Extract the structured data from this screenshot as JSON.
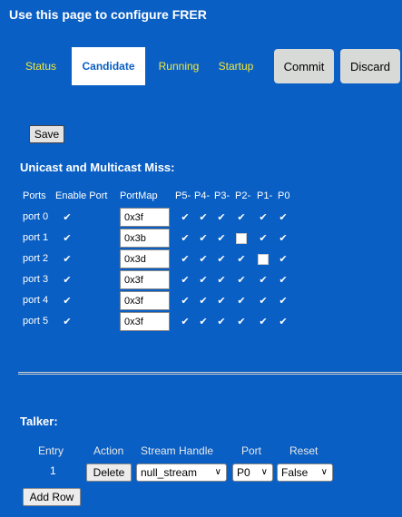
{
  "page_title": "Use this page to configure FRER",
  "tabs": [
    "Status",
    "Candidate",
    "Running",
    "Startup"
  ],
  "active_tab": "Candidate",
  "commit_label": "Commit",
  "discard_label": "Discard",
  "save_label": "Save",
  "miss": {
    "title": "Unicast and Multicast Miss:",
    "headers": [
      "Ports",
      "Enable Port",
      "PortMap",
      "P5-",
      "P4-",
      "P3-",
      "P2-",
      "P1-",
      "P0"
    ],
    "rows": [
      {
        "port": "port 0",
        "enable": true,
        "portmap": "0x3f",
        "bits": [
          true,
          true,
          true,
          true,
          true,
          true
        ]
      },
      {
        "port": "port 1",
        "enable": true,
        "portmap": "0x3b",
        "bits": [
          true,
          true,
          true,
          false,
          true,
          true
        ]
      },
      {
        "port": "port 2",
        "enable": true,
        "portmap": "0x3d",
        "bits": [
          true,
          true,
          true,
          true,
          false,
          true
        ]
      },
      {
        "port": "port 3",
        "enable": true,
        "portmap": "0x3f",
        "bits": [
          true,
          true,
          true,
          true,
          true,
          true
        ]
      },
      {
        "port": "port 4",
        "enable": true,
        "portmap": "0x3f",
        "bits": [
          true,
          true,
          true,
          true,
          true,
          true
        ]
      },
      {
        "port": "port 5",
        "enable": true,
        "portmap": "0x3f",
        "bits": [
          true,
          true,
          true,
          true,
          true,
          true
        ]
      }
    ]
  },
  "talker": {
    "title": "Talker:",
    "headers": [
      "Entry",
      "Action",
      "Stream Handle",
      "Port",
      "Reset"
    ],
    "rows": [
      {
        "entry": "1",
        "action": "Delete",
        "stream_handle": "null_stream",
        "port": "P0",
        "reset": "False"
      }
    ],
    "add_row_label": "Add Row"
  },
  "colors": {
    "background": "#0a5fc4",
    "tab_text": "#f5e93a",
    "text": "#ffffff"
  }
}
